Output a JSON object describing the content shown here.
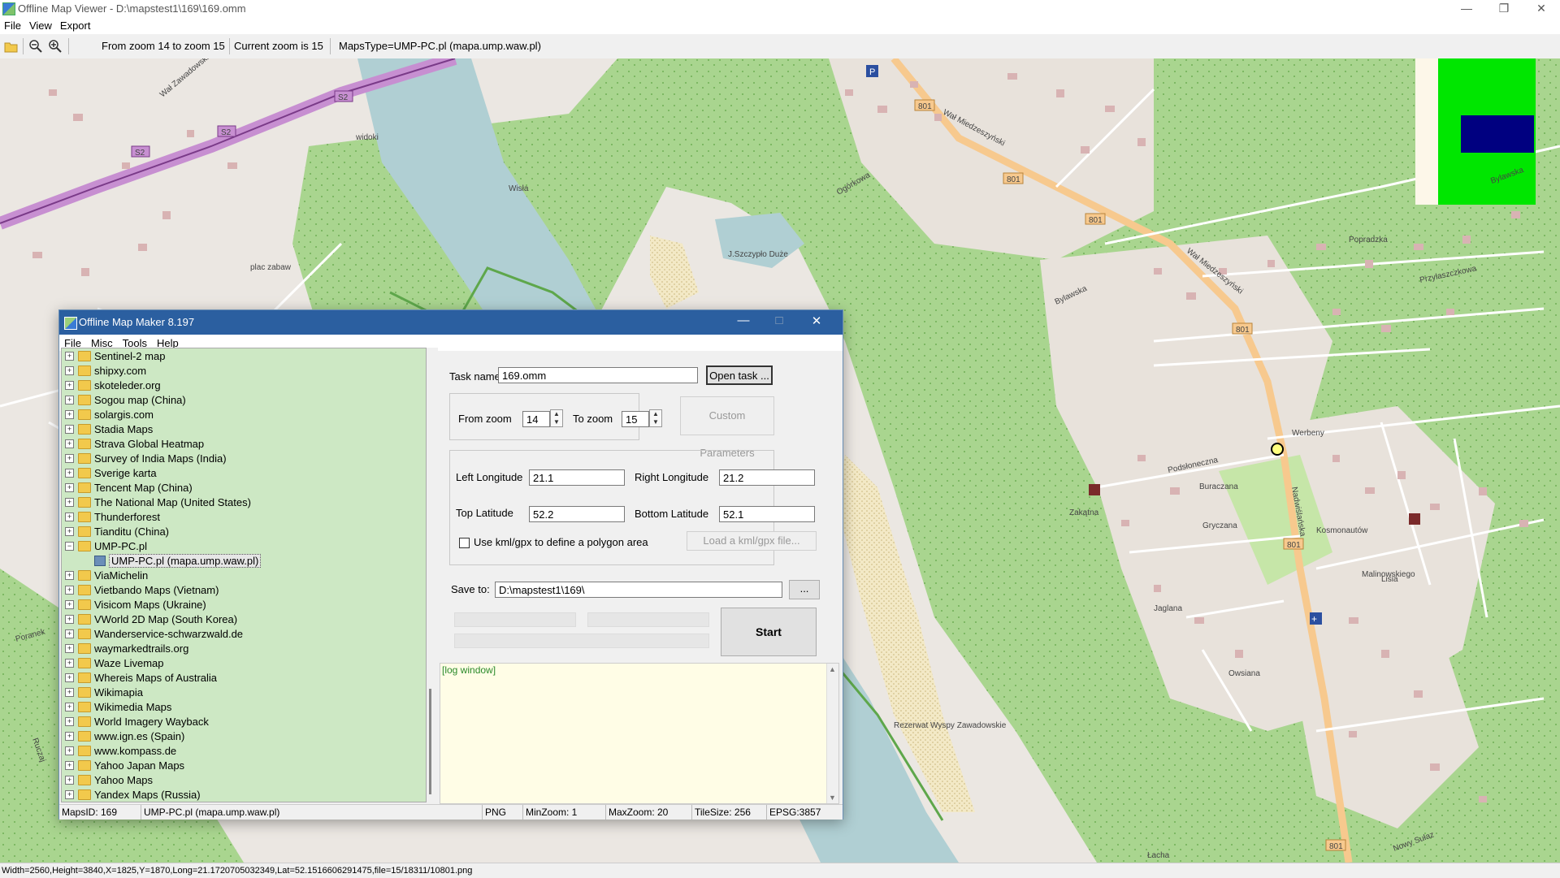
{
  "viewer": {
    "title": "Offline Map Viewer - D:\\mapstest1\\169\\169.omm",
    "menu": [
      "File",
      "View",
      "Export"
    ],
    "toolbar": {
      "zoom_range": "From zoom 14 to zoom 15",
      "current_zoom": "Current zoom is 15",
      "maps_type": "MapsType=UMP-PC.pl (mapa.ump.waw.pl)"
    },
    "statusbar": "Width=2560,Height=3840,X=1825,Y=1870,Long=21.1720705032349,Lat=52.1516606291475,file=15/18311/10801.png"
  },
  "map": {
    "labels": {
      "road_s2": "S2",
      "road_801": "801",
      "river": "Wisła",
      "widoki": "widoki",
      "plac": "plac zabaw",
      "szczyplo": "J.Szczypło Duże",
      "rezerwat": "Rezerwat Wyspy Zawadowskie",
      "wal_miedzeszynski": "Wał Miedzeszyński",
      "nadwislanska": "Nadwiślańska",
      "wal_zawadowski": "Wał Zawadowski",
      "ogorkowa": "Ogórkowa",
      "bylawska": "Bylawska",
      "werbeny": "Werbeny",
      "kosmonautow": "Kosmonautów",
      "gryczana": "Gryczana",
      "zakatna": "Zakątna",
      "buraczana": "Buraczana",
      "podsiolneczna": "Podsłoneczna",
      "jaglana": "Jaglana",
      "owsiana": "Owsiana",
      "lisia": "Lisia",
      "przylaszczkowa": "Przylaszczkowa",
      "popradzka": "Popradzka",
      "malinowskiego": "Malinowskiego",
      "lacha": "Łacha",
      "nowy_sulaz": "Nowy Sułaz",
      "poranek": "Poranek",
      "ruczaj": "Ruczaj"
    }
  },
  "maker": {
    "title": "Offline Map Maker 8.197",
    "menu": [
      "File",
      "Misc",
      "Tools",
      "Help"
    ],
    "tree": [
      {
        "label": "Sentinel-2 map",
        "type": "folder"
      },
      {
        "label": "shipxy.com",
        "type": "folder"
      },
      {
        "label": "skoteleder.org",
        "type": "folder"
      },
      {
        "label": "Sogou map (China)",
        "type": "folder"
      },
      {
        "label": "solargis.com",
        "type": "folder"
      },
      {
        "label": "Stadia Maps",
        "type": "folder"
      },
      {
        "label": "Strava Global Heatmap",
        "type": "folder"
      },
      {
        "label": "Survey of India Maps (India)",
        "type": "folder"
      },
      {
        "label": "Sverige karta",
        "type": "folder"
      },
      {
        "label": "Tencent Map (China)",
        "type": "folder"
      },
      {
        "label": "The National Map (United States)",
        "type": "folder"
      },
      {
        "label": "Thunderforest",
        "type": "folder"
      },
      {
        "label": "Tianditu (China)",
        "type": "folder"
      },
      {
        "label": "UMP-PC.pl",
        "type": "folder-open"
      },
      {
        "label": "UMP-PC.pl (mapa.ump.waw.pl)",
        "type": "map",
        "selected": true
      },
      {
        "label": "ViaMichelin",
        "type": "folder"
      },
      {
        "label": "Vietbando Maps (Vietnam)",
        "type": "folder"
      },
      {
        "label": "Visicom Maps (Ukraine)",
        "type": "folder"
      },
      {
        "label": "VWorld 2D Map (South Korea)",
        "type": "folder"
      },
      {
        "label": "Wanderservice-schwarzwald.de",
        "type": "folder"
      },
      {
        "label": "waymarkedtrails.org",
        "type": "folder"
      },
      {
        "label": "Waze Livemap",
        "type": "folder"
      },
      {
        "label": "Whereis Maps of Australia",
        "type": "folder"
      },
      {
        "label": "Wikimapia",
        "type": "folder"
      },
      {
        "label": "Wikimedia Maps",
        "type": "folder"
      },
      {
        "label": "World Imagery Wayback",
        "type": "folder"
      },
      {
        "label": "www.ign.es (Spain)",
        "type": "folder"
      },
      {
        "label": "www.kompass.de",
        "type": "folder"
      },
      {
        "label": "Yahoo Japan Maps",
        "type": "folder"
      },
      {
        "label": "Yahoo Maps",
        "type": "folder"
      },
      {
        "label": "Yandex Maps (Russia)",
        "type": "folder"
      }
    ],
    "form": {
      "task_name_label": "Task name",
      "task_name_value": "169.omm",
      "open_task_button": "Open task ...",
      "from_zoom_label": "From zoom",
      "from_zoom_value": "14",
      "to_zoom_label": "To zoom",
      "to_zoom_value": "15",
      "custom_params_button": "Custom Parameters",
      "left_lon_label": "Left Longitude",
      "left_lon_value": "21.1",
      "right_lon_label": "Right Longitude",
      "right_lon_value": "21.2",
      "top_lat_label": "Top Latitude",
      "top_lat_value": "52.2",
      "bottom_lat_label": "Bottom Latitude",
      "bottom_lat_value": "52.1",
      "kml_checkbox_label": "Use kml/gpx to define a polygon area",
      "kml_checked": false,
      "load_kml_button": "Load a kml/gpx file...",
      "save_to_label": "Save to:",
      "save_to_value": "D:\\mapstest1\\169\\",
      "browse_button": "...",
      "start_button": "Start",
      "log_text": "[log window]"
    },
    "status": {
      "maps_id": "MapsID: 169",
      "maps_name": "UMP-PC.pl (mapa.ump.waw.pl)",
      "format": "PNG",
      "min_zoom": "MinZoom: 1",
      "max_zoom": "MaxZoom: 20",
      "tile_size": "TileSize: 256",
      "epsg": "EPSG:3857"
    }
  },
  "colors": {
    "forest": "#a9d58f",
    "forest_dark": "#7bbf5f",
    "water": "#b0cfd3",
    "road_orange": "#f7c98e",
    "expressway": "#c78fd1",
    "residential": "#e3dcd6",
    "building": "#d8b3b3",
    "tree_bg": "#cde8c4",
    "log_bg": "#fffde6",
    "log_text": "#2a8a2a",
    "dialog_title": "#2b5fa0"
  }
}
